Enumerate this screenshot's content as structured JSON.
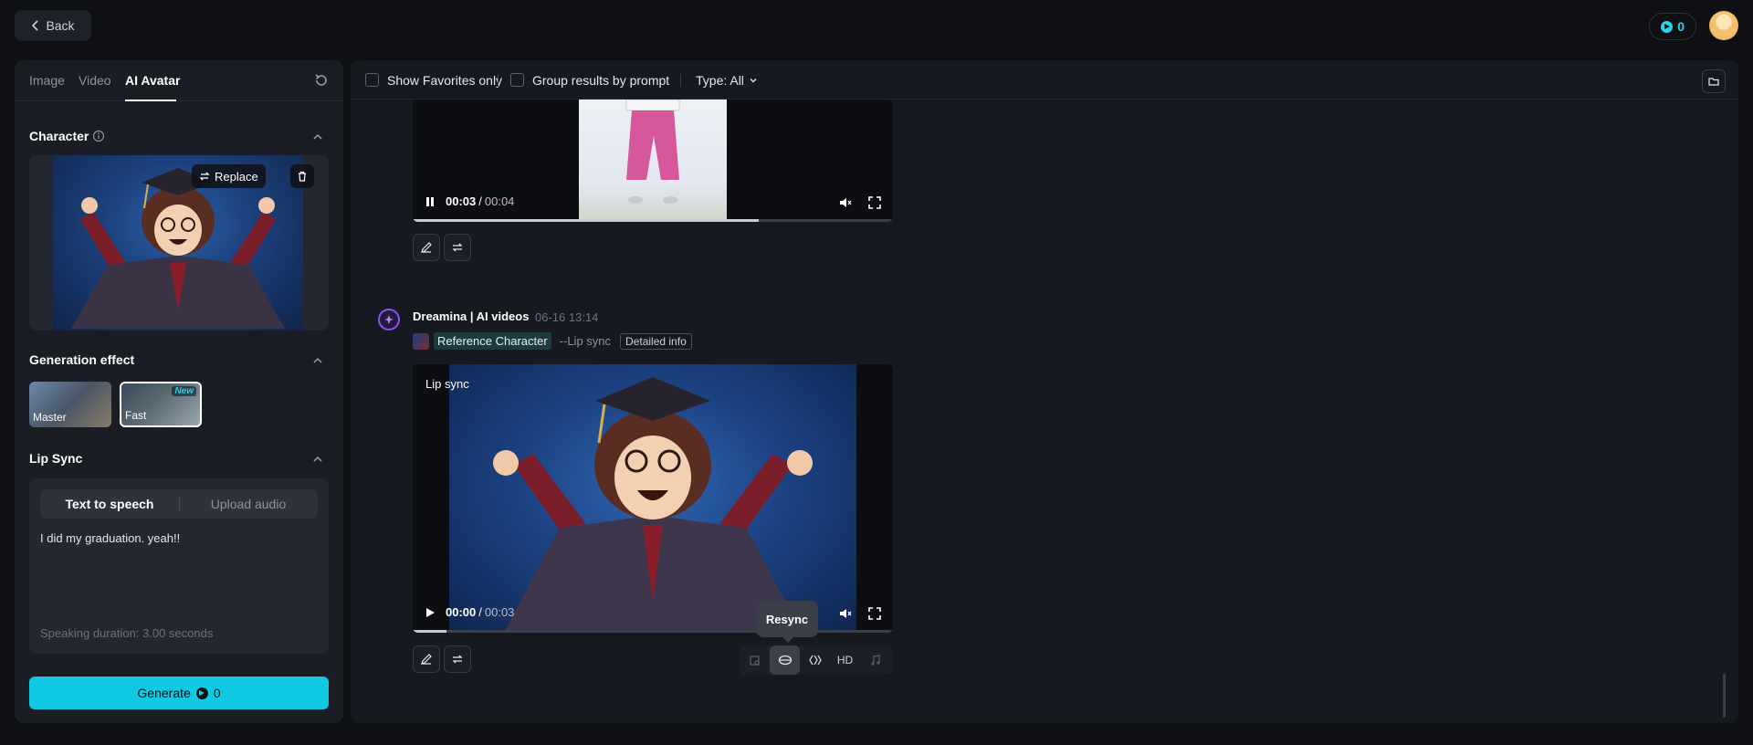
{
  "topbar": {
    "back_label": "Back",
    "credits": "0"
  },
  "left": {
    "tabs": [
      "Image",
      "Video",
      "AI Avatar"
    ],
    "character": {
      "title": "Character",
      "replace_label": "Replace"
    },
    "generation_effect": {
      "title": "Generation effect",
      "options": [
        {
          "label": "Master"
        },
        {
          "label": "Fast",
          "badge": "New"
        }
      ]
    },
    "lip_sync": {
      "title": "Lip Sync",
      "modes": [
        "Text to speech",
        "Upload audio"
      ],
      "text": "I did my graduation. yeah!!",
      "duration": "Speaking duration: 3.00 seconds"
    },
    "generate": {
      "label": "Generate",
      "cost": "0"
    }
  },
  "main": {
    "toolbar": {
      "favorites": "Show Favorites only",
      "group": "Group results by prompt",
      "type": "Type: All"
    },
    "video1": {
      "current": "00:03",
      "sep": "/",
      "total": "00:04",
      "progress": 0.72
    },
    "message": {
      "author": "Dreamina | AI videos",
      "time": "06-16  13:14",
      "ref_name": "Reference Character",
      "ref_suffix": "--Lip sync",
      "detail_label": "Detailed info"
    },
    "video2": {
      "overlay": "Lip sync",
      "current": "00:00",
      "sep": "/",
      "total": "00:03",
      "progress": 0.07
    },
    "tooltip": "Resync",
    "tools": {
      "hd": "HD"
    }
  },
  "colors": {
    "accent": "#12c9e4",
    "brand_purple": "#8a54f5"
  }
}
